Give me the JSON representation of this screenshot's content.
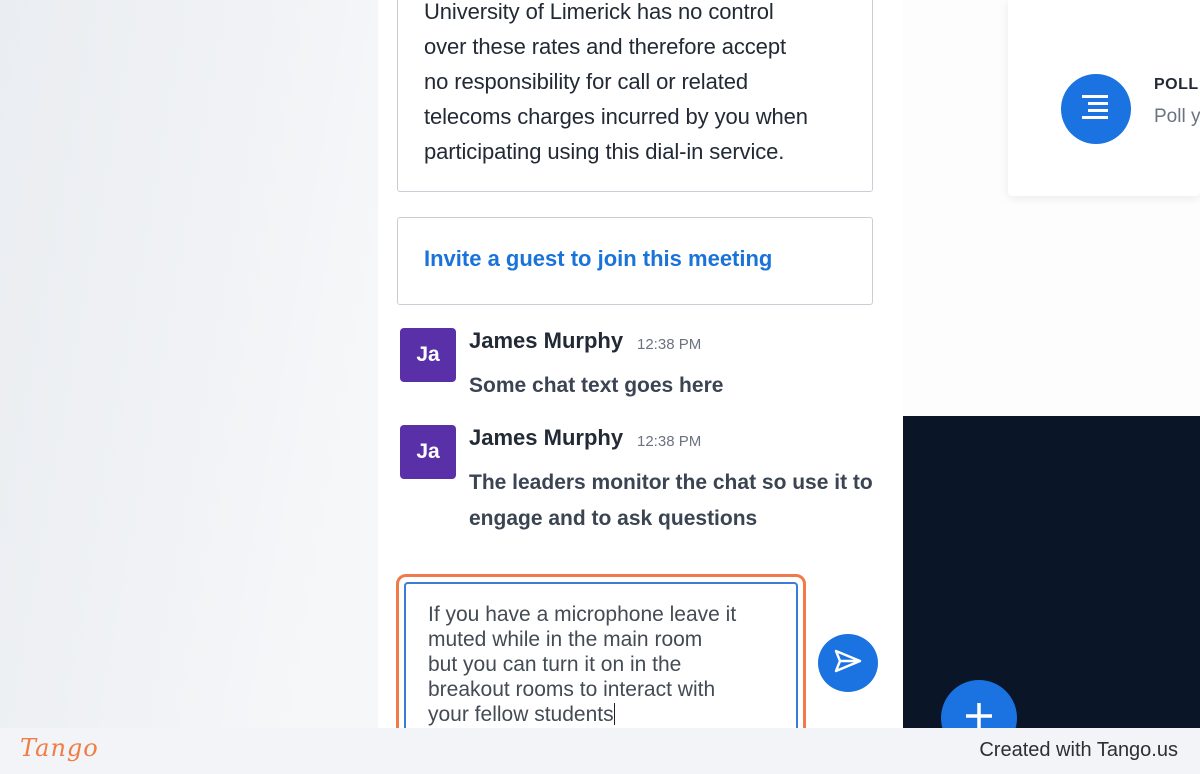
{
  "dialin": {
    "lines": [
      "University of Limerick has no control",
      "over these rates and therefore accept",
      "no responsibility for call or related",
      "telecoms charges incurred by you when",
      "participating using this dial-in service."
    ]
  },
  "invite": {
    "label": "Invite a guest to join this meeting"
  },
  "messages": [
    {
      "initials": "Ja",
      "name": "James Murphy",
      "time": "12:38 PM",
      "text": "Some chat text goes here"
    },
    {
      "initials": "Ja",
      "name": "James Murphy",
      "time": "12:38 PM",
      "text": "The leaders monitor the chat so use it to engage and to ask questions"
    }
  ],
  "composer": {
    "lines": [
      "If you have a microphone leave it",
      "muted while in the main room",
      "but you can turn it on in the",
      "breakout rooms to interact with",
      "your fellow students"
    ]
  },
  "poll": {
    "title": "POLL",
    "subtitle": "Poll y"
  },
  "footer": {
    "logo": "Tango",
    "credit": "Created with Tango.us"
  },
  "colors": {
    "accent": "#1a73e0",
    "avatar": "#5a30a8",
    "highlight": "#f07a4a",
    "dark_panel": "#0a1528"
  },
  "icons": {
    "send": "send-icon",
    "poll": "list-icon",
    "add": "plus-icon"
  }
}
